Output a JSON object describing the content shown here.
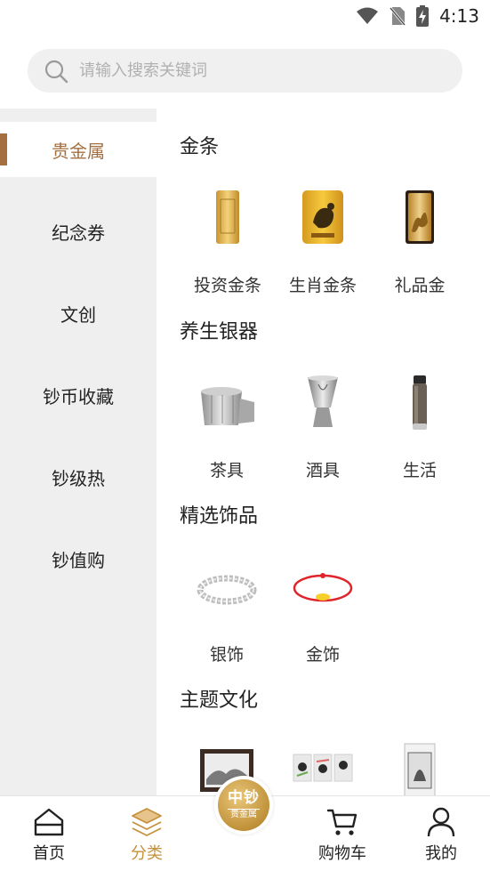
{
  "status_bar": {
    "time": "4:13"
  },
  "search": {
    "placeholder": "请输入搜索关键词"
  },
  "sidebar": {
    "items": [
      {
        "label": "贵金属",
        "active": true
      },
      {
        "label": "纪念券",
        "active": false
      },
      {
        "label": "文创",
        "active": false
      },
      {
        "label": "钞币收藏",
        "active": false
      },
      {
        "label": "钞级热",
        "active": false
      },
      {
        "label": "钞值购",
        "active": false
      }
    ]
  },
  "sections": [
    {
      "title": "金条",
      "products": [
        {
          "label": "投资金条"
        },
        {
          "label": "生肖金条"
        },
        {
          "label": "礼品金"
        }
      ]
    },
    {
      "title": "养生银器",
      "products": [
        {
          "label": "茶具"
        },
        {
          "label": "酒具"
        },
        {
          "label": "生活"
        }
      ]
    },
    {
      "title": "精选饰品",
      "products": [
        {
          "label": "银饰"
        },
        {
          "label": "金饰"
        }
      ]
    },
    {
      "title": "主题文化",
      "products": [
        {
          "label": ""
        },
        {
          "label": ""
        },
        {
          "label": ""
        }
      ]
    }
  ],
  "bottom_nav": {
    "items": [
      {
        "label": "首页",
        "icon": "home-icon"
      },
      {
        "label": "分类",
        "icon": "layers-icon",
        "active": true
      },
      {
        "label": "购物车",
        "icon": "cart-icon"
      },
      {
        "label": "我的",
        "icon": "user-icon"
      }
    ],
    "center_badge": {
      "line1": "中钞",
      "line2": "贵金属"
    }
  },
  "colors": {
    "accent": "#a5703f",
    "nav_active": "#c5913b",
    "sidebar_bg": "#efefef"
  }
}
